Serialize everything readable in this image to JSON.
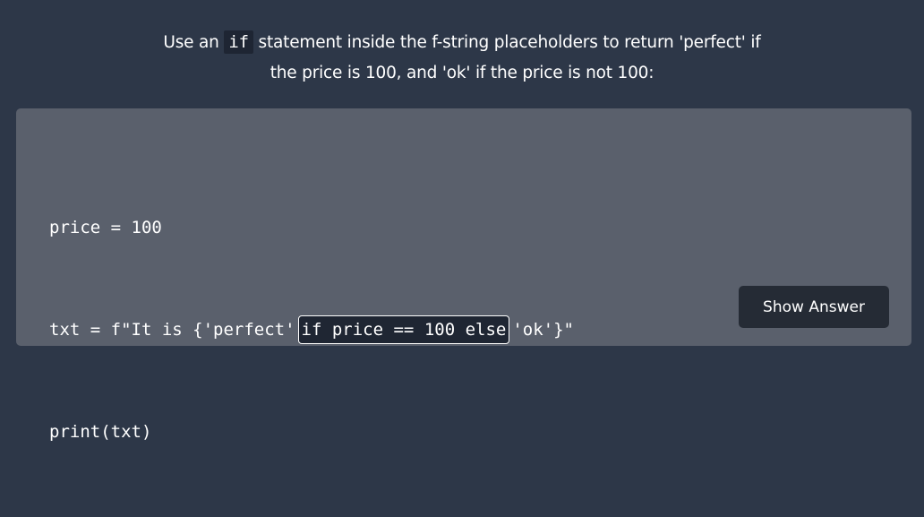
{
  "instruction": {
    "part1": "Use an ",
    "code": "if",
    "part2": " statement inside the f-string placeholders to return 'perfect' if",
    "line2": "the price is 100, and 'ok' if the price is not 100:"
  },
  "code": {
    "line1": "price = 100",
    "line2_prefix": "txt = f\"It is {'perfect'",
    "line2_blank": "if price == 100 else",
    "line2_suffix": "'ok'}\"",
    "line3": "print(txt)"
  },
  "show_answer_label": "Show Answer"
}
